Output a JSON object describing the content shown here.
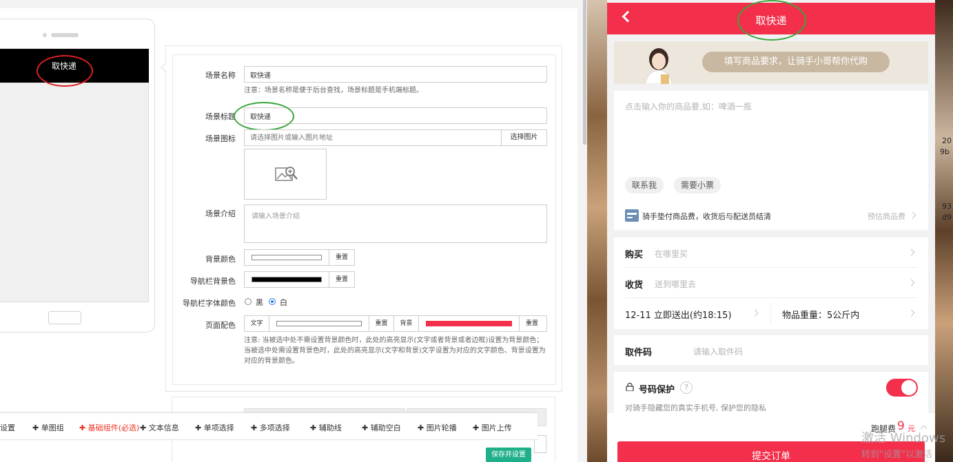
{
  "editor": {
    "preview_nav_title": "取快递",
    "fields": {
      "scene_name_label": "场景名称",
      "scene_name_value": "取快递",
      "scene_name_note": "注意：场景名称是便于后台查找，场景标题是手机端标题。",
      "scene_title_label": "场景标题",
      "scene_title_value": "取快递",
      "scene_icon_label": "场景图标",
      "scene_icon_placeholder": "请选择图片或输入图片地址",
      "choose_image_label": "选择图片",
      "scene_intro_label": "场景介绍",
      "scene_intro_placeholder": "请输入场景介绍",
      "bg_color_label": "背景颜色",
      "nav_bg_color_label": "导航栏背景色",
      "nav_font_color_label": "导航栏字体颜色",
      "nav_font_black": "黑",
      "nav_font_white": "白",
      "page_color_label": "页面配色",
      "page_color_text_label": "文字",
      "page_color_bg_label": "背景",
      "reset_label": "重置",
      "page_color_note": "注意: 当被选中处不需设置背景颜色时，此处的高亮显示(文字或者背景或者边框)设置为背景颜色；当被选中处需设置背景色时，此处的高亮显示(文字和背景)文字设置为对应的文字颜色、背景设置为对应的背景颜色。"
    },
    "colors": {
      "bg_color": "#ffffff",
      "nav_bg_color": "#000000",
      "page_text_color": "#ffffff",
      "page_bg_color": "#f32f4b"
    },
    "toolbar": {
      "items": [
        "设置",
        "单图组",
        "基础组件(必选)",
        "文本信息",
        "单项选择",
        "多项选择",
        "辅助线",
        "辅助空白",
        "图片轮播",
        "图片上传"
      ],
      "save_label": "保存并设置"
    }
  },
  "mobile": {
    "header_title": "取快递",
    "banner_text": "填写商品要求，让骑手小哥帮你代购",
    "goods_placeholder": "点击输入你的商品要,如：啤酒一瓶",
    "tags": [
      "联系我",
      "需要小票"
    ],
    "advance_note": "骑手垫付商品费，收货后与配送员结清",
    "estimate_label": "预估商品费",
    "buy_label": "购买",
    "buy_placeholder": "在哪里买",
    "receive_label": "收货",
    "receive_placeholder": "送到哪里去",
    "delivery_time": "12-11 立即送出(约18:15)",
    "weight": "物品重量：5公斤内",
    "pickup_code_label": "取件码",
    "pickup_code_placeholder": "请输入取件码",
    "privacy_label": "号码保护",
    "privacy_help": "?",
    "privacy_note": "对骑手隐藏您的真实手机号, 保护您的隐私",
    "fee_label": "跑腿费",
    "fee_value": "9",
    "fee_unit": "元",
    "submit_label": "提交订单",
    "accent_color": "#f32f4b"
  },
  "desktop": {
    "side_texts": [
      "20",
      "9b",
      "93",
      "d9"
    ],
    "watermark_title": "激活 Windows",
    "watermark_sub": "转到\"设置\"以激活"
  }
}
